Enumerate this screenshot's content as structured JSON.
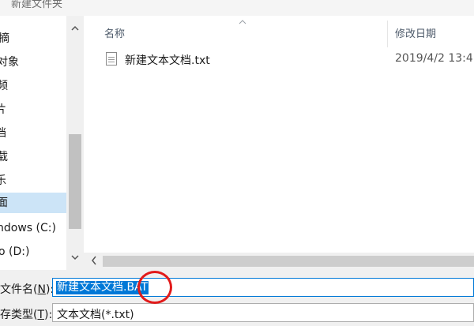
{
  "window": {
    "path_title": "新建文件夹"
  },
  "nav": {
    "items": [
      {
        "label": "摘"
      },
      {
        "label": "对象"
      },
      {
        "label": "频"
      },
      {
        "label": "片"
      },
      {
        "label": "档"
      },
      {
        "label": "载"
      },
      {
        "label": "乐"
      },
      {
        "label": "面"
      },
      {
        "label": "ndows (C:)"
      },
      {
        "label": "o (D:)"
      }
    ],
    "selected_index": 7
  },
  "file_list": {
    "columns": {
      "name": "名称",
      "modified": "修改日期"
    },
    "files": [
      {
        "name": "新建文本文档.txt",
        "modified": "2019/4/2 13:4"
      }
    ]
  },
  "bottom": {
    "filename_label": "文件名(",
    "filename_key": "N",
    "filename_label_end": "):",
    "filename_value": "新建文本文档.BAT",
    "filetype_label": "存类型(",
    "filetype_key": "T",
    "filetype_label_end": "):",
    "filetype_value": "文本文档(*.txt)"
  },
  "colors": {
    "selection": "#0078d7",
    "nav_selected": "#cce4f7",
    "annotation": "#e21a1a"
  }
}
